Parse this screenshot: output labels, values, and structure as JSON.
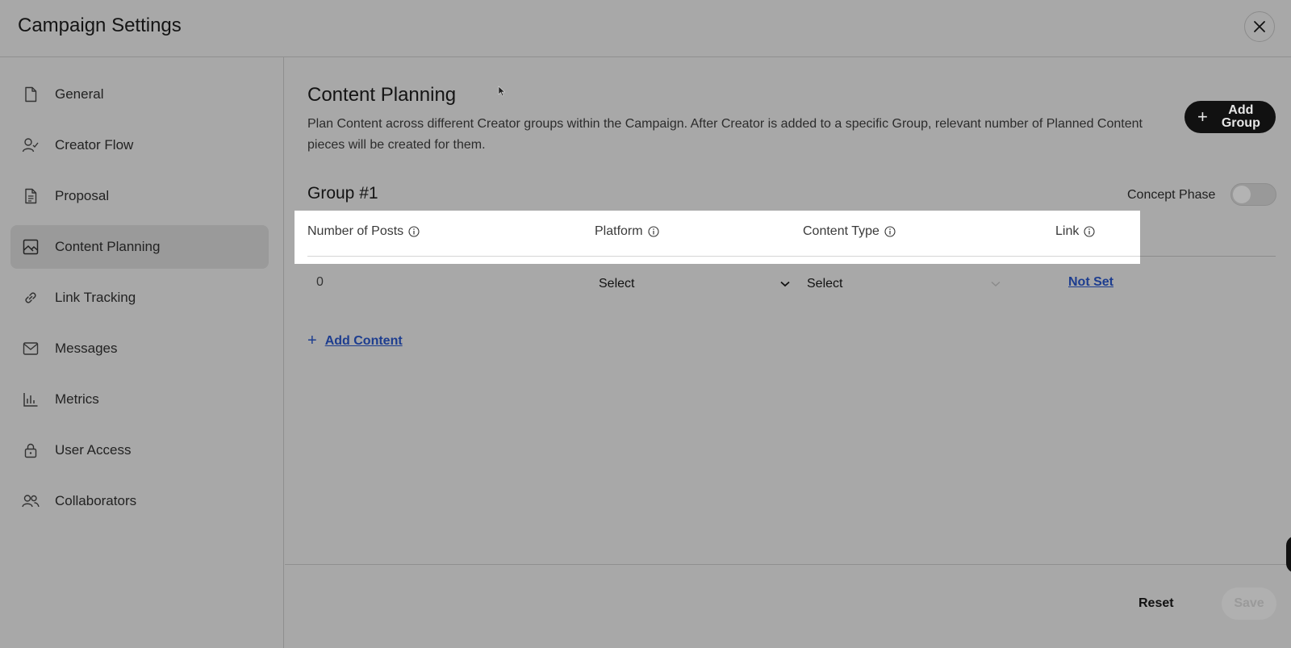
{
  "header": {
    "title": "Campaign Settings"
  },
  "sidebar": {
    "items": [
      {
        "label": "General",
        "icon": "document-icon"
      },
      {
        "label": "Creator Flow",
        "icon": "user-flow-icon"
      },
      {
        "label": "Proposal",
        "icon": "file-text-icon"
      },
      {
        "label": "Content Planning",
        "icon": "image-icon",
        "active": true
      },
      {
        "label": "Link Tracking",
        "icon": "link-icon"
      },
      {
        "label": "Messages",
        "icon": "mail-icon"
      },
      {
        "label": "Metrics",
        "icon": "bar-chart-icon"
      },
      {
        "label": "User Access",
        "icon": "lock-icon"
      },
      {
        "label": "Collaborators",
        "icon": "users-icon"
      }
    ]
  },
  "main": {
    "title": "Content Planning",
    "description": "Plan Content across different Creator groups within the Campaign. After Creator is added to a specific Group, relevant number of Planned Content pieces will be created for them.",
    "add_group_label": "Add Group",
    "group": {
      "title": "Group #1",
      "concept_phase_label": "Concept Phase",
      "concept_phase_on": false,
      "columns": [
        "Number of Posts",
        "Platform",
        "Content Type",
        "Link"
      ],
      "row": {
        "posts": "0",
        "platform": "Select",
        "content_type": "Select",
        "link": "Not Set"
      },
      "add_content_label": "Add Content"
    }
  },
  "footer": {
    "reset_label": "Reset",
    "save_label": "Save"
  },
  "colors": {
    "link": "#1d3d8f",
    "overlay": "#a8a8a8",
    "highlight": "#ffffff"
  }
}
